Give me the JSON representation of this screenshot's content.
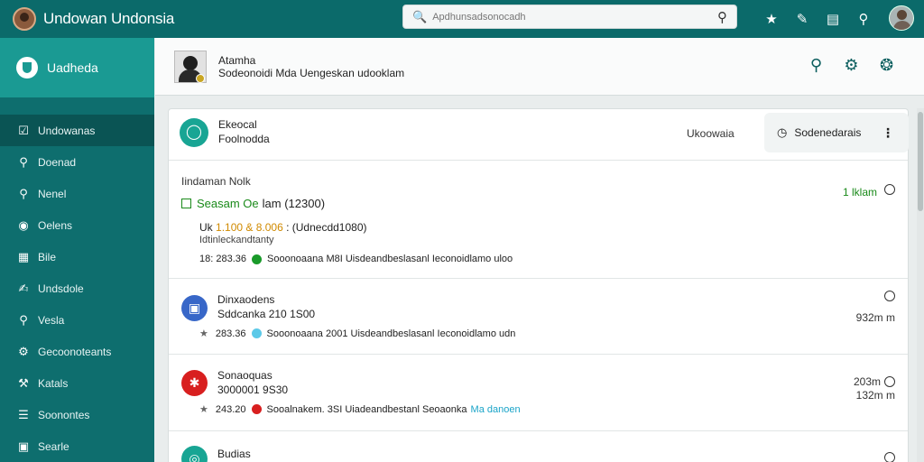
{
  "topbar": {
    "title": "Undowan Undonsia",
    "search_placeholder": "Apdhunsadsonocadh",
    "icons": [
      "star-icon",
      "edit-icon",
      "reader-icon",
      "search-icon",
      "avatar"
    ]
  },
  "sidebar": {
    "header_label": "Uadheda",
    "items": [
      {
        "label": "Undowanas",
        "icon": "checkbox-icon",
        "active": true
      },
      {
        "label": "Doenad",
        "icon": "search-icon",
        "active": false
      },
      {
        "label": "Nenel",
        "icon": "search-icon",
        "active": false
      },
      {
        "label": "Oelens",
        "icon": "location-icon",
        "active": false
      },
      {
        "label": "Bile",
        "icon": "table-icon",
        "active": false
      },
      {
        "label": "Undsdole",
        "icon": "edit-icon",
        "active": false
      },
      {
        "label": "Vesla",
        "icon": "pin-icon",
        "active": false
      },
      {
        "label": "Gecoonoteants",
        "icon": "gear-icon",
        "active": false
      },
      {
        "label": "Katals",
        "icon": "wrench-icon",
        "active": false
      },
      {
        "label": "Soonontes",
        "icon": "list-icon",
        "active": false
      },
      {
        "label": "Searle",
        "icon": "image-icon",
        "active": false
      }
    ]
  },
  "header": {
    "title": "Atamha",
    "subtitle": "Sodeonoidi Mda Uengeskan udooklam"
  },
  "card": {
    "title": "Ekeocal",
    "subtitle": "Foolnodda",
    "status": "Ukoowaia",
    "filter_label": "Sodenedarais",
    "filter_more": "⋮"
  },
  "rows": [
    {
      "label": "Iindaman Nolk",
      "heading": "Seasam Oe",
      "heading_value": "lam (12300)",
      "line1_prefix": "Uk",
      "line1_amount": "1.100 & 8.006",
      "line1_suffix": ": (Udnecdd1080)",
      "line2": "Idtinleckandtanty",
      "meta_num": "18: 283.36",
      "meta_text": "Sooonoaana M8I Uisdeandbeslasanl Ieconoidlamo uloo",
      "time": "1 lklam",
      "dot_color": "#1a9a2a"
    },
    {
      "title": "Dinxaodens",
      "sub": "Sddcanka 210 1S00",
      "meta_num": "283.36",
      "meta_text": "Sooonoaana 2001 Uisdeandbeslasanl Ieconoidlamo udn",
      "time": "932m m",
      "dot_color": "#5cc9e8",
      "icon_color": "#3867c8",
      "icon": "■"
    },
    {
      "title": "Sonaoquas",
      "sub": "3000001 9S30",
      "meta_num": "243.20",
      "meta_text": "Sooalnakem. 3SI Uiadeandbestanl Seoaonka",
      "meta_link": "Ma danoen",
      "time": "203m",
      "time2": "132m m",
      "dot_color": "#d81f1f",
      "icon_color": "#d81f1f",
      "icon": "✱"
    },
    {
      "title": "Budias",
      "icon_color": "#18a594",
      "icon": "◎"
    }
  ]
}
